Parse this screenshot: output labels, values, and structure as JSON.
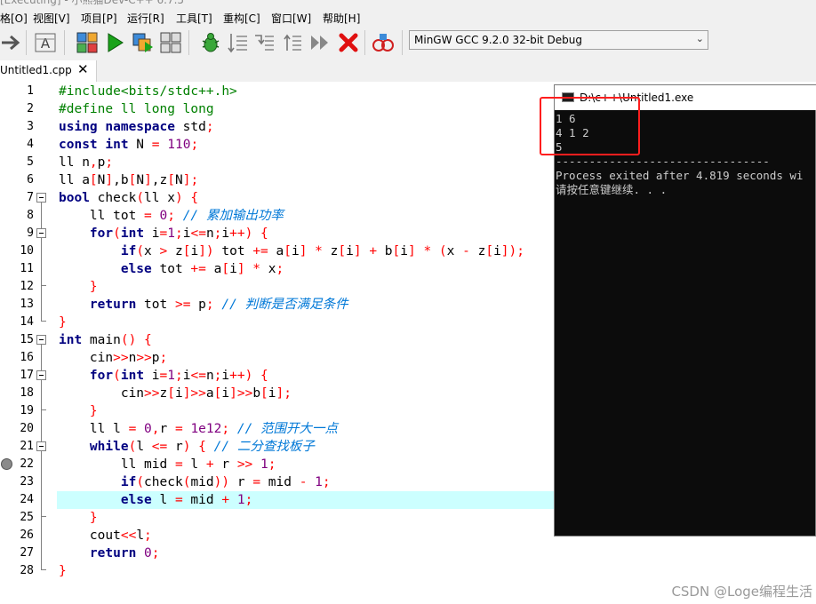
{
  "window": {
    "title": "[Executing] - 小熊猫Dev-C++ 6.7.5"
  },
  "menu": {
    "items": [
      {
        "label": "格[O]"
      },
      {
        "label": "视图[V]"
      },
      {
        "label": "项目[P]"
      },
      {
        "label": "运行[R]"
      },
      {
        "label": "工具[T]"
      },
      {
        "label": "重构[C]"
      },
      {
        "label": "窗口[W]"
      },
      {
        "label": "帮助[H]"
      }
    ]
  },
  "toolbar": {
    "icons": [
      "goto-arrow-icon",
      "format-code-icon",
      "compile-icon",
      "run-icon",
      "compile-run-icon",
      "rebuild-icon",
      "debug-icon",
      "step-over-icon",
      "step-into-icon",
      "step-out-icon",
      "continue-icon",
      "stop-icon",
      "profile-icon"
    ],
    "compiler_selected": "MinGW GCC 9.2.0 32-bit Debug"
  },
  "editor": {
    "tab_label": "Untitled1.cpp",
    "line_numbers": [
      "1",
      "2",
      "3",
      "4",
      "5",
      "6",
      "7",
      "8",
      "9",
      "10",
      "11",
      "12",
      "13",
      "14",
      "15",
      "16",
      "17",
      "18",
      "19",
      "20",
      "21",
      "22",
      "23",
      "24",
      "25",
      "26",
      "27",
      "28"
    ],
    "highlighted_line": 24,
    "breakpoint_line": 22
  },
  "console": {
    "title": "D:\\c++\\Untitled1.exe",
    "lines": [
      "1 6",
      "4 1 2",
      "5",
      "--------------------------------",
      "Process exited after 4.819 seconds wi",
      "请按任意键继续. . ."
    ]
  },
  "watermark": "CSDN @Loge编程生活",
  "colors": {
    "keyword": "#000080",
    "symbol": "#ff0000",
    "number": "#800080",
    "comment": "#0078d7",
    "preprocessor": "#008000",
    "current_line": "#ccffff",
    "annotation_box": "#ff1e1e"
  }
}
